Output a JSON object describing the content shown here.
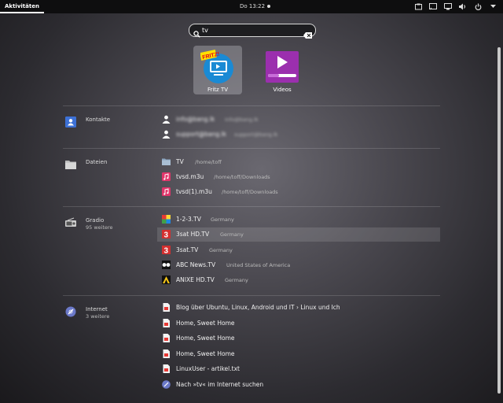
{
  "topbar": {
    "activities": "Aktivitäten",
    "clock": "Do 13:22"
  },
  "search": {
    "query": "tv"
  },
  "apps": [
    {
      "label": "Fritz TV",
      "badge": "FRITZ!"
    },
    {
      "label": "Videos"
    }
  ],
  "kontakte": {
    "name": "Kontakte",
    "items": [
      {
        "title": "info@bang.lk",
        "detail": "info@bang.lk"
      },
      {
        "title": "support@bang.lk",
        "detail": "support@bang.lk"
      }
    ]
  },
  "dateien": {
    "name": "Dateien",
    "items": [
      {
        "title": "TV",
        "detail": "/home/toff"
      },
      {
        "title": "tvsd.m3u",
        "detail": "/home/toff/Downloads"
      },
      {
        "title": "tvsd(1).m3u",
        "detail": "/home/toff/Downloads"
      }
    ]
  },
  "gradio": {
    "name": "Gradio",
    "sub": "95 weitere",
    "items": [
      {
        "title": "1-2-3.TV",
        "detail": "Germany",
        "icon": "tv123-icon"
      },
      {
        "title": "3sat HD.TV",
        "detail": "Germany",
        "icon": "3sat-icon"
      },
      {
        "title": "3sat.TV",
        "detail": "Germany",
        "icon": "3sat-icon"
      },
      {
        "title": "ABC News.TV",
        "detail": "United States of America",
        "icon": "abc-icon"
      },
      {
        "title": "ANIXE HD.TV",
        "detail": "Germany",
        "icon": "anixe-icon"
      }
    ]
  },
  "internet": {
    "name": "Internet",
    "sub": "3 weitere",
    "items": [
      {
        "title": "Blog über Ubuntu, Linux, Android und IT › Linux und Ich"
      },
      {
        "title": "Home, Sweet Home"
      },
      {
        "title": "Home, Sweet Home"
      },
      {
        "title": "Home, Sweet Home"
      },
      {
        "title": "LinuxUser - artikel.txt"
      },
      {
        "title": "Nach »tv« im Internet suchen"
      }
    ]
  }
}
